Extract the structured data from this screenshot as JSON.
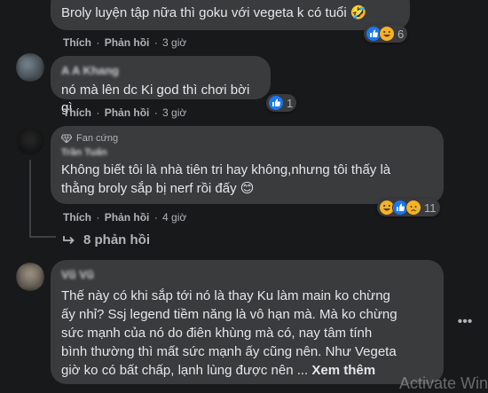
{
  "comments": [
    {
      "text": "Broly luyện tập nữa thì goku với vegeta k có tuổi 🤣",
      "like_label": "Thích",
      "reply_label": "Phản hồi",
      "time": "3 giờ",
      "reaction_count": "6"
    },
    {
      "author": "A A Khang",
      "text": "nó mà lên dc Ki god thì chơi bời gì",
      "like_label": "Thích",
      "reply_label": "Phản hồi",
      "time": "3 giờ",
      "reaction_count": "1"
    },
    {
      "fan_badge": "Fan cứng",
      "author": "Trần Tuấn",
      "text": "Không biết tôi là nhà tiên tri hay không,nhưng tôi thấy là\nthằng broly sắp bị nerf rồi đấy 😊",
      "like_label": "Thích",
      "reply_label": "Phản hồi",
      "time": "4 giờ",
      "reaction_count": "11"
    },
    {
      "author": "Vũ Vũ",
      "text": "Thế này có khi sắp tới nó là thay Ku làm main ko chừng\nấy nhỉ? Ssj legend tiềm năng là vô hạn mà. Mà ko chừng\nsức mạnh của nó do điên khùng mà có, nay tâm tính\nbình thường thì mất sức mạnh ấy cũng nên. Như Vegeta\ngiờ ko có bất chấp, lạnh lùng được nên ...",
      "see_more": "Xem thêm"
    }
  ],
  "replies_link": "8 phản hồi",
  "more_icon": "•••",
  "watermark": "Activate Win"
}
